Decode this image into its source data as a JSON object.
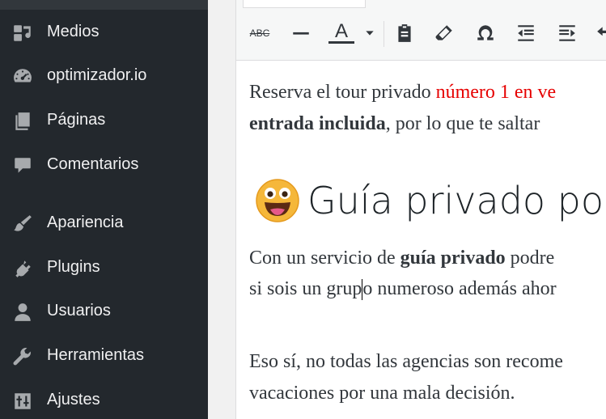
{
  "sidebar": {
    "items": [
      {
        "label": "Medios",
        "icon": "media-icon"
      },
      {
        "label": "optimizador.io",
        "icon": "speedometer-icon"
      },
      {
        "label": "Páginas",
        "icon": "pages-icon"
      },
      {
        "label": "Comentarios",
        "icon": "comment-icon"
      },
      {
        "label": "Apariencia",
        "icon": "paintbrush-icon"
      },
      {
        "label": "Plugins",
        "icon": "plugin-icon"
      },
      {
        "label": "Usuarios",
        "icon": "user-icon"
      },
      {
        "label": "Herramientas",
        "icon": "wrench-icon"
      },
      {
        "label": "Ajustes",
        "icon": "settings-sliders-icon"
      }
    ]
  },
  "toolbar": {
    "strikethrough_label": "ABC",
    "text_color_label": "A"
  },
  "content": {
    "p1_line1_plain": "Reserva el tour privado ",
    "p1_line1_red": "número 1 en ve",
    "p1_line2_bold": "entrada incluida",
    "p1_line2_rest": ", por lo que te saltar",
    "heading_text": "Guía privado por e",
    "p2_line1_plain": "Con un servicio de ",
    "p2_line1_bold": "guía privado",
    "p2_line1_rest": " podre",
    "p2_line2_before_caret": "si sois un grup",
    "p2_line2_after_caret": "o numeroso además ahor",
    "p3_line1": "Eso sí, no todas las agencias son recome",
    "p3_line2": "vacaciones por una mala decisión."
  },
  "colors": {
    "sidebar_bg": "#23282d",
    "sidebar_icon": "#a7aaad",
    "highlight_red": "#e60000",
    "emoji_yellow": "#f5b73a"
  }
}
